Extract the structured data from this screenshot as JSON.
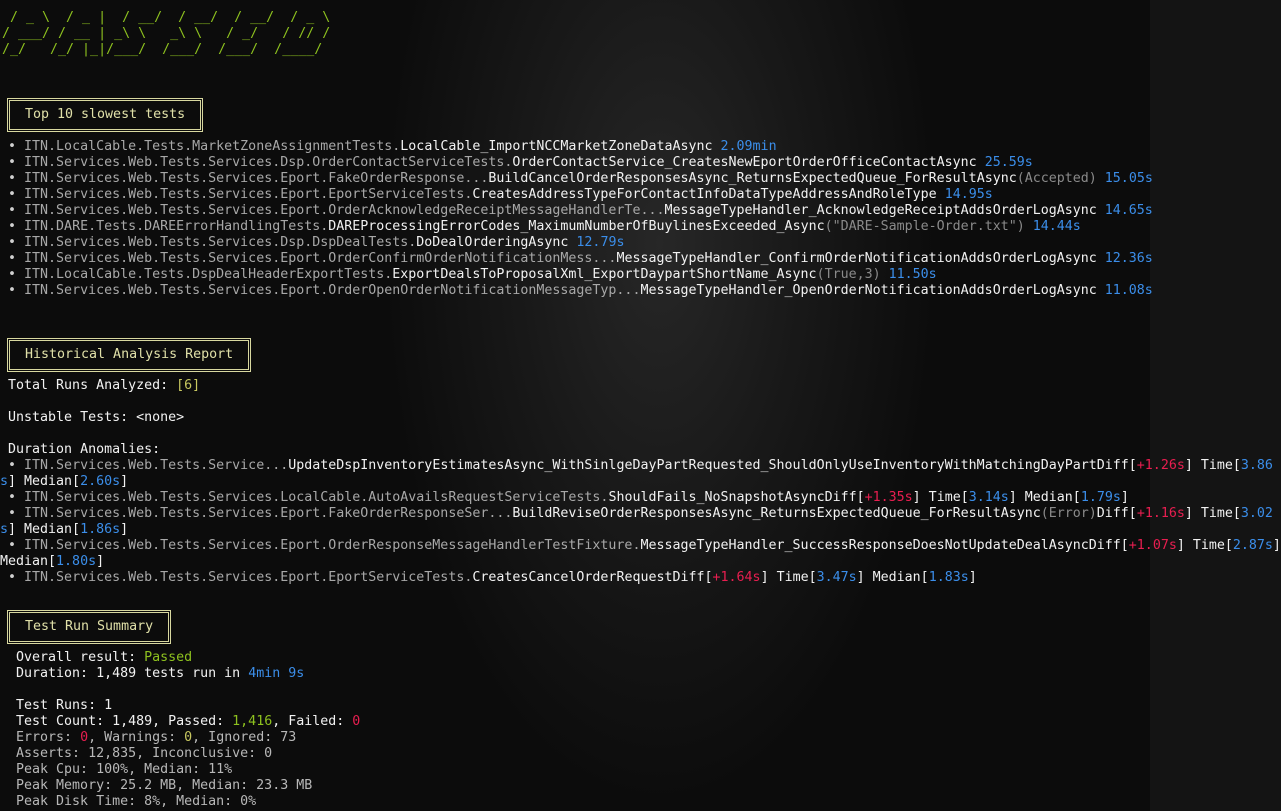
{
  "banner": {
    "ascii_lines": [
      " / _ \\  / _ |  / __/  / __/  / __/  / _ \\",
      "/ ___/ / __ | _\\ \\   _\\ \\   / _/   / // /",
      "/_/   /_/ |_|/___/  /___/  /___/  /____/"
    ],
    "color": "#8ec21f"
  },
  "slowest": {
    "title": "Top 10 slowest tests",
    "items": [
      {
        "ns": "ITN.LocalCable.Tests.MarketZoneAssignmentTests.",
        "method": "LocalCable_ImportNCCMarketZoneDataAsync",
        "args": "",
        "time": "2.09min"
      },
      {
        "ns": "ITN.Services.Web.Tests.Services.Dsp.OrderContactServiceTests.",
        "method": "OrderContactService_CreatesNewEportOrderOfficeContactAsync",
        "args": "",
        "time": "25.59s"
      },
      {
        "ns": "ITN.Services.Web.Tests.Services.Eport.FakeOrderResponse...",
        "method": "BuildCancelOrderResponsesAsync_ReturnsExpectedQueue_ForResultAsync",
        "args": "(Accepted)",
        "time": "15.05s"
      },
      {
        "ns": "ITN.Services.Web.Tests.Services.Eport.EportServiceTests.",
        "method": "CreatesAddressTypeForContactInfoDataTypeAddressAndRoleType",
        "args": "",
        "time": "14.95s"
      },
      {
        "ns": "ITN.Services.Web.Tests.Services.Eport.OrderAcknowledgeReceiptMessageHandlerTe...",
        "method": "MessageTypeHandler_AcknowledgeReceiptAddsOrderLogAsync",
        "args": "",
        "time": "14.65s"
      },
      {
        "ns": "ITN.DARE.Tests.DAREErrorHandlingTests.",
        "method": "DAREProcessingErrorCodes_MaximumNumberOfBuylinesExceeded_Async",
        "args": "(\"DARE-Sample-Order.txt\")",
        "time": "14.44s"
      },
      {
        "ns": "ITN.Services.Web.Tests.Services.Dsp.DspDealTests.",
        "method": "DoDealOrderingAsync",
        "args": "",
        "time": "12.79s"
      },
      {
        "ns": "ITN.Services.Web.Tests.Services.Eport.OrderConfirmOrderNotificationMess...",
        "method": "MessageTypeHandler_ConfirmOrderNotificationAddsOrderLogAsync",
        "args": "",
        "time": "12.36s"
      },
      {
        "ns": "ITN.LocalCable.Tests.DspDealHeaderExportTests.",
        "method": "ExportDealsToProposalXml_ExportDaypartShortName_Async",
        "args": "(True,3)",
        "time": "11.50s"
      },
      {
        "ns": "ITN.Services.Web.Tests.Services.Eport.OrderOpenOrderNotificationMessageTyp...",
        "method": "MessageTypeHandler_OpenOrderNotificationAddsOrderLogAsync",
        "args": "",
        "time": "11.08s"
      }
    ]
  },
  "history": {
    "title": "Historical Analysis Report",
    "total_runs_label": "Total Runs Analyzed: ",
    "total_runs": "[6]",
    "unstable_label": "Unstable Tests: ",
    "unstable_value": "<none>",
    "anomalies_label": "Duration Anomalies:",
    "anomalies": [
      {
        "ns": "ITN.Services.Web.Tests.Service...",
        "method": "UpdateDspInventoryEstimatesAsync_WithSinlgeDayPartRequested_ShouldOnlyUseInventoryWithMatchingDayPart",
        "args": "",
        "diff": "+1.26s",
        "time": "3.86s",
        "median": "2.60s"
      },
      {
        "ns": "ITN.Services.Web.Tests.Services.LocalCable.AutoAvailsRequestServiceTests.",
        "method": "ShouldFails_NoSnapshotAsync",
        "args": "",
        "diff": "+1.35s",
        "time": "3.14s",
        "median": "1.79s"
      },
      {
        "ns": "ITN.Services.Web.Tests.Services.Eport.FakeOrderResponseSer...",
        "method": "BuildReviseOrderResponsesAsync_ReturnsExpectedQueue_ForResultAsync",
        "args": "(Error)",
        "diff": "+1.16s",
        "time": "3.02s",
        "median": "1.86s"
      },
      {
        "ns": "ITN.Services.Web.Tests.Services.Eport.OrderResponseMessageHandlerTestFixture.",
        "method": "MessageTypeHandler_SuccessResponseDoesNotUpdateDealAsync",
        "args": "",
        "diff": "+1.07s",
        "time": "2.87s",
        "median": "1.80s"
      },
      {
        "ns": "ITN.Services.Web.Tests.Services.Eport.EportServiceTests.",
        "method": "CreatesCancelOrderRequest",
        "args": "",
        "diff": "+1.64s",
        "time": "3.47s",
        "median": "1.83s"
      }
    ]
  },
  "summary": {
    "title": "Test Run Summary",
    "overall_label": "Overall result: ",
    "overall_value": "Passed",
    "duration_label": "Duration: 1,489 tests run in ",
    "duration_value": "4min 9s",
    "test_runs": "Test Runs: 1",
    "count_label": "Test Count: 1,489, Passed: ",
    "passed": "1,416",
    "failed_label": ", Failed: ",
    "failed": "0",
    "errors_label": "Errors: ",
    "errors": "0",
    "warnings_label": ", Warnings: ",
    "warnings": "0",
    "ignored": ", Ignored: 73",
    "asserts": "Asserts: 12,835, Inconclusive: 0",
    "cpu": "Peak Cpu: 100%, Median: 11%",
    "memory": "Peak Memory: 25.2 MB, Median: 23.3 MB",
    "disk": "Peak Disk Time: 8%, Median: 0%"
  },
  "colors": {
    "time": "#3b8eea",
    "fail": "#e81e50",
    "pass": "#8ec21f",
    "box": "#d8d8a0"
  }
}
